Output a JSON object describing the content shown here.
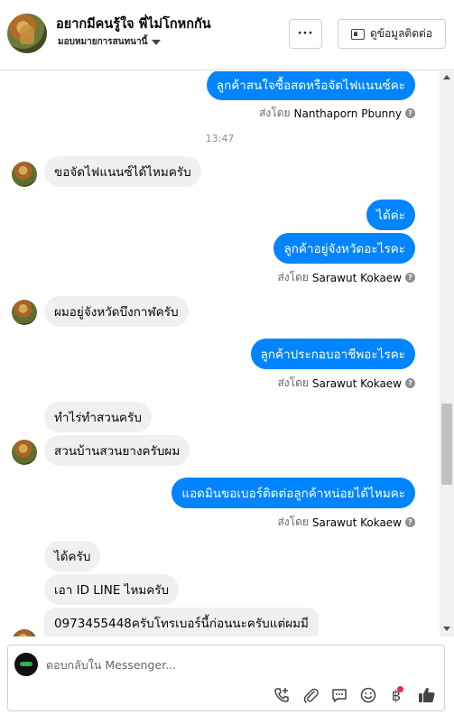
{
  "header": {
    "title": "อยากมีคนรู้ใจ พี่ไม่โกหกกัน",
    "assign_label": "มอบหมายการสนทนานี้",
    "more_label": "···",
    "info_label": "ดูข้อมูลติดต่อ"
  },
  "messages": {
    "m1": "ลูกค้าสนใจซื้อสดหรือจัดไฟแนนซ์คะ",
    "m1_sent_prefix": "ส่งโดย",
    "m1_sent_name": "Nanthaporn Pbunny",
    "time1": "13:47",
    "m2": "ขอจัดไฟแนนซ์ได้ไหมครับ",
    "m3": "ได้ค่ะ",
    "m4": "ลูกค้าอยู่จังหวัดอะไรคะ",
    "m4_sent_prefix": "ส่งโดย",
    "m4_sent_name": "Sarawut Kokaew",
    "m5": "ผมอยู่จังหวัดบึงกาฬครับ",
    "m6": "ลูกค้าประกอบอาชีพอะไรคะ",
    "m6_sent_prefix": "ส่งโดย",
    "m6_sent_name": "Sarawut Kokaew",
    "m7": "ทำไร่ทำสวนครับ",
    "m8": "สวนบ้านสวนยางครับผม",
    "m9": "แอดมินขอเบอร์ติดต่อลูกค้าหน่อยได้ไหมคะ",
    "m9_sent_prefix": "ส่งโดย",
    "m9_sent_name": "Sarawut Kokaew",
    "m10": "ได้ครับ",
    "m11": "เอา ID LINE ไหมครับ",
    "m12": "0973455448ครับโทรเบอร์นี้ก่อนนะครับแต่ผมมี"
  },
  "composer": {
    "placeholder": "ตอบกลับใน Messenger..."
  },
  "icons": {
    "call": "phone-plus-icon",
    "attach": "paperclip-icon",
    "saved_replies": "chat-bubble-icon",
    "emoji": "smiley-icon",
    "payment": "baht-icon",
    "like": "thumbs-up-icon"
  },
  "colors": {
    "outgoing_bubble": "#0084ff",
    "incoming_bubble": "#f0f0f0",
    "like_blue": "#1877f2",
    "badge_red": "#f02849"
  }
}
